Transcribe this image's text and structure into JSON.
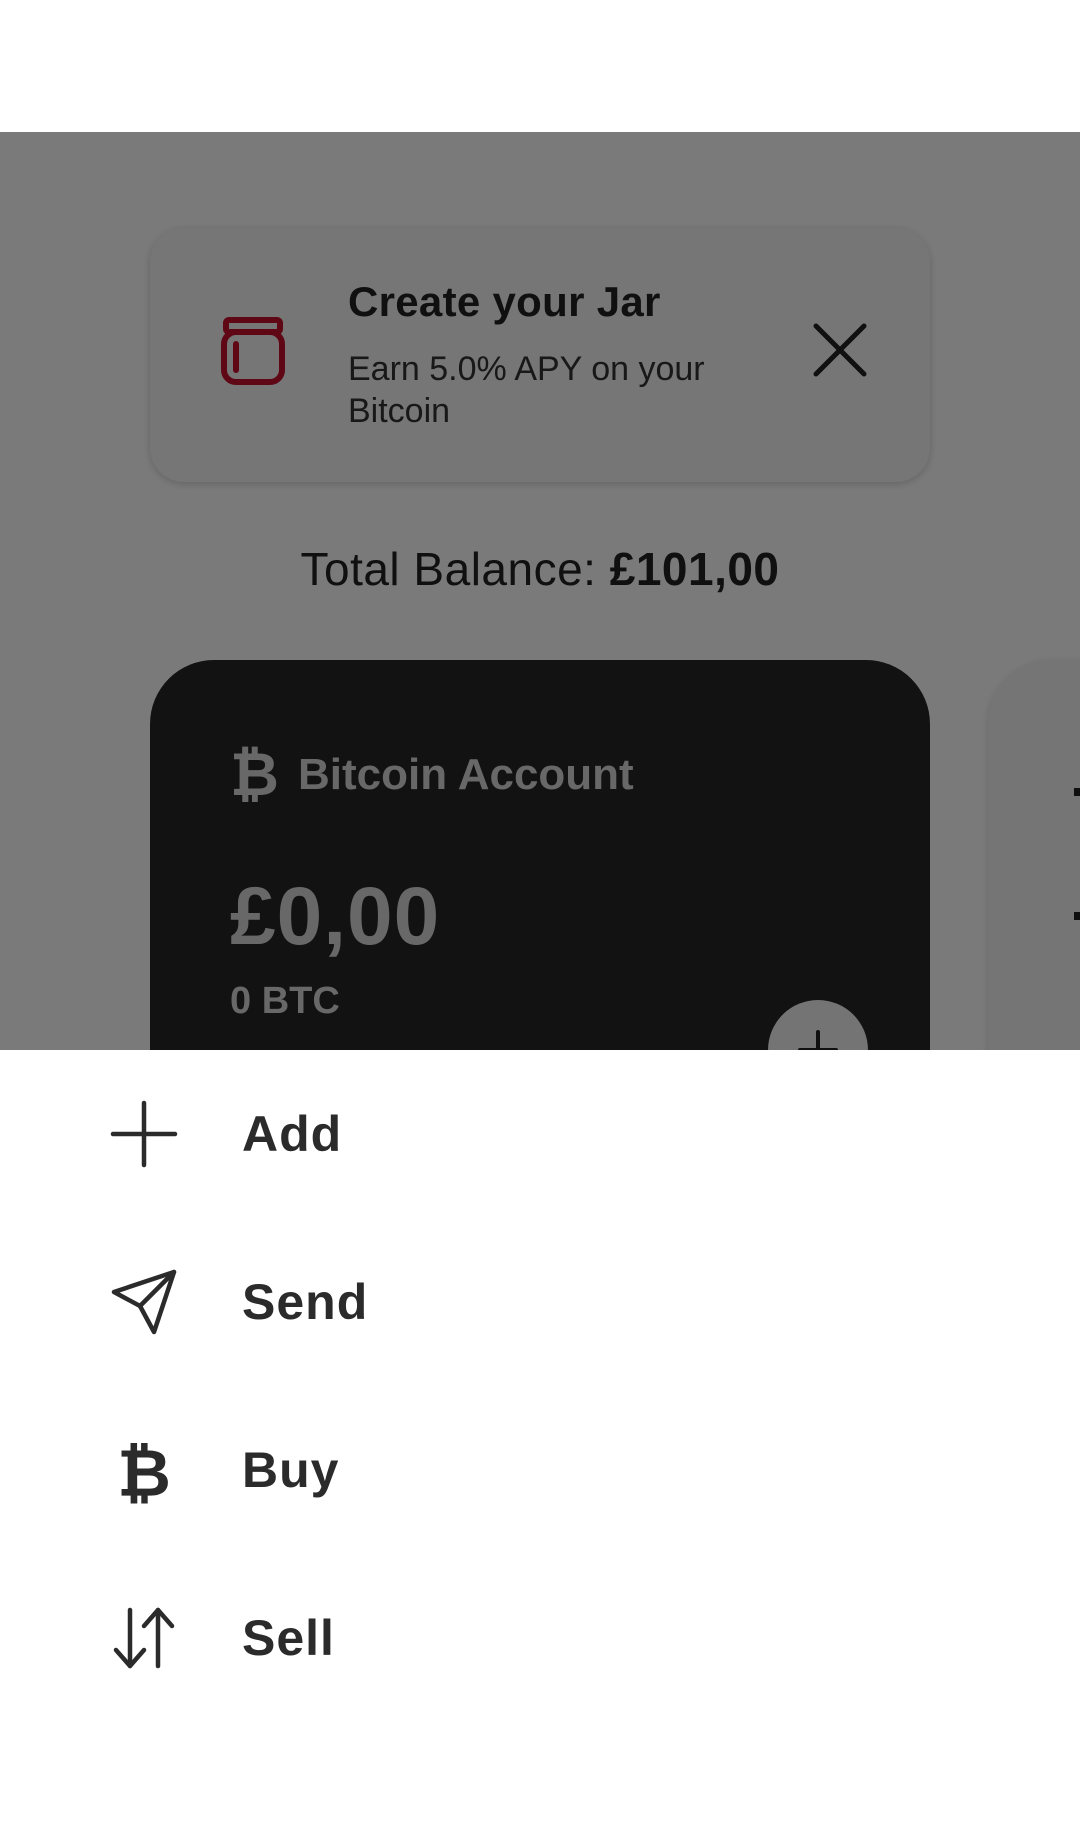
{
  "promo": {
    "title": "Create your Jar",
    "subtitle": "Earn 5.0% APY on your Bitcoin",
    "icon": "jar-icon",
    "close_icon": "close-icon",
    "accent_color": "#c8102e"
  },
  "balance": {
    "label": "Total Balance: ",
    "amount": "£101,00"
  },
  "account_card": {
    "icon": "bitcoin-icon",
    "icon_glyph": "₿",
    "name": "Bitcoin Account",
    "fiat_balance": "£0,00",
    "crypto_balance": "0 BTC",
    "add_icon": "plus-icon"
  },
  "action_sheet": {
    "items": [
      {
        "label": "Add",
        "icon": "plus-icon"
      },
      {
        "label": "Send",
        "icon": "send-icon"
      },
      {
        "label": "Buy",
        "icon": "bitcoin-icon"
      },
      {
        "label": "Sell",
        "icon": "swap-arrows-icon"
      }
    ]
  }
}
